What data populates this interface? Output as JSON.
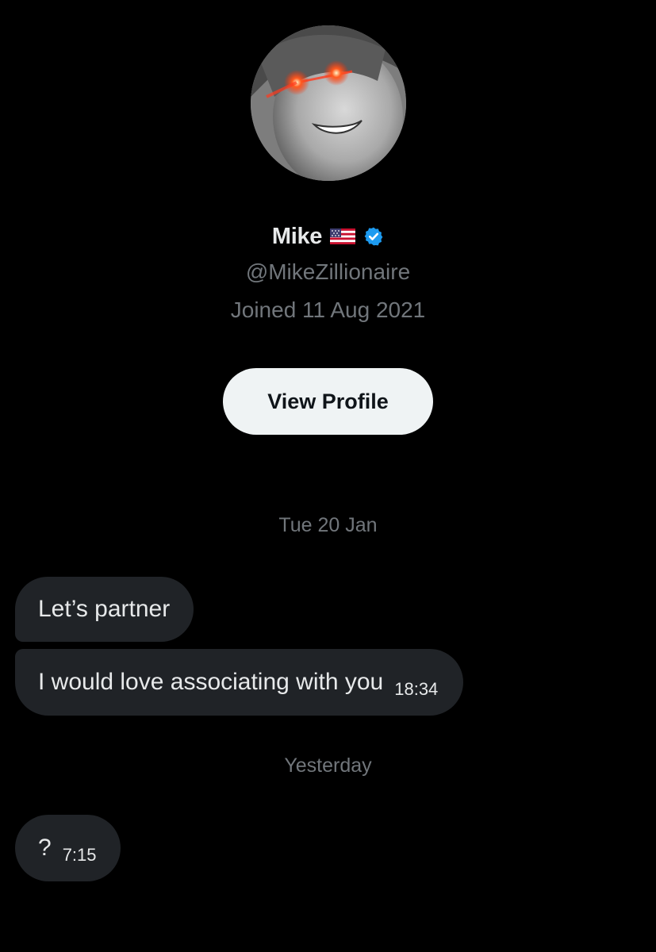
{
  "profile": {
    "display_name": "Mike",
    "flag_icon": "us-flag-emoji",
    "verified_icon": "verified-badge-icon",
    "verified_color": "#1d9bf0",
    "handle": "@MikeZillionaire",
    "joined": "Joined 11 Aug 2021",
    "view_profile_label": "View Profile"
  },
  "conversation": {
    "sections": [
      {
        "date_label": "Tue 20 Jan",
        "messages": [
          {
            "text": "Let’s partner",
            "time": ""
          },
          {
            "text": "I would love associating with you",
            "time": "18:34"
          }
        ]
      },
      {
        "date_label": "Yesterday",
        "messages": [
          {
            "text": "?",
            "time": "7:15"
          }
        ]
      }
    ]
  },
  "colors": {
    "background": "#000000",
    "primary_text": "#e7e9ea",
    "secondary_text": "#71767b",
    "bubble": "#202327",
    "button_bg": "#eff3f4",
    "button_text": "#0f1419"
  }
}
